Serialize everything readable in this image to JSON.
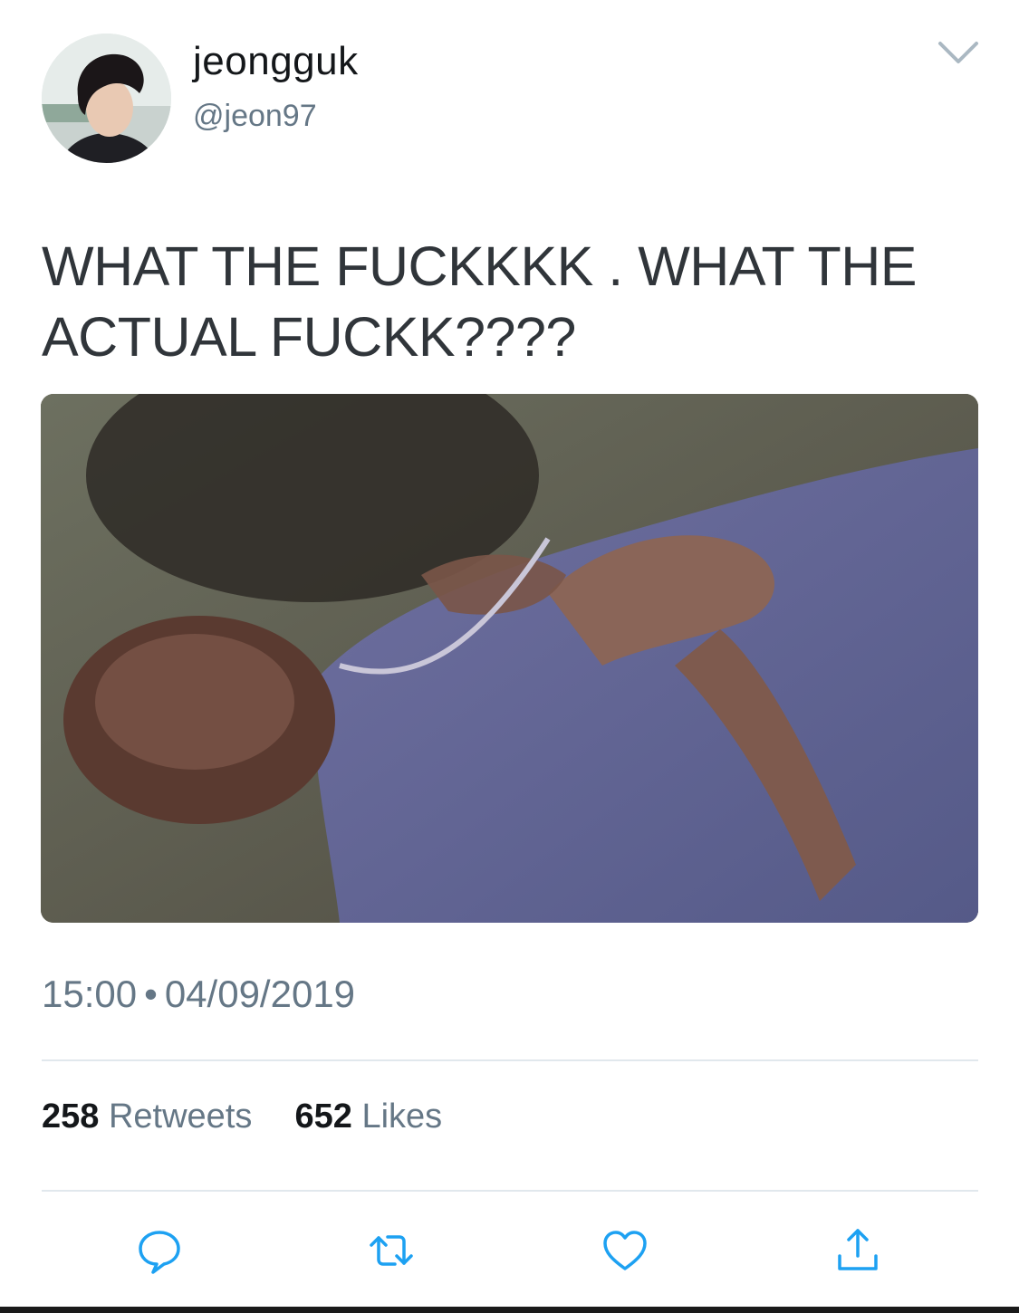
{
  "user": {
    "display_name": "jeongguk",
    "handle": "@jeon97"
  },
  "tweet": {
    "text": "WHAT THE FUCKKKK . WHAT THE ACTUAL FUCKK????",
    "time": "15:00",
    "separator": "•",
    "date": "04/09/2019"
  },
  "stats": {
    "retweets_count": "258",
    "retweets_label": "Retweets",
    "likes_count": "652",
    "likes_label": "Likes"
  },
  "icons": {
    "menu": "chevron-down-icon",
    "reply": "reply-icon",
    "retweet": "retweet-icon",
    "like": "heart-icon",
    "share": "share-icon"
  },
  "colors": {
    "text_primary": "#14171a",
    "text_secondary": "#657786",
    "divider": "#e1e8ed"
  }
}
